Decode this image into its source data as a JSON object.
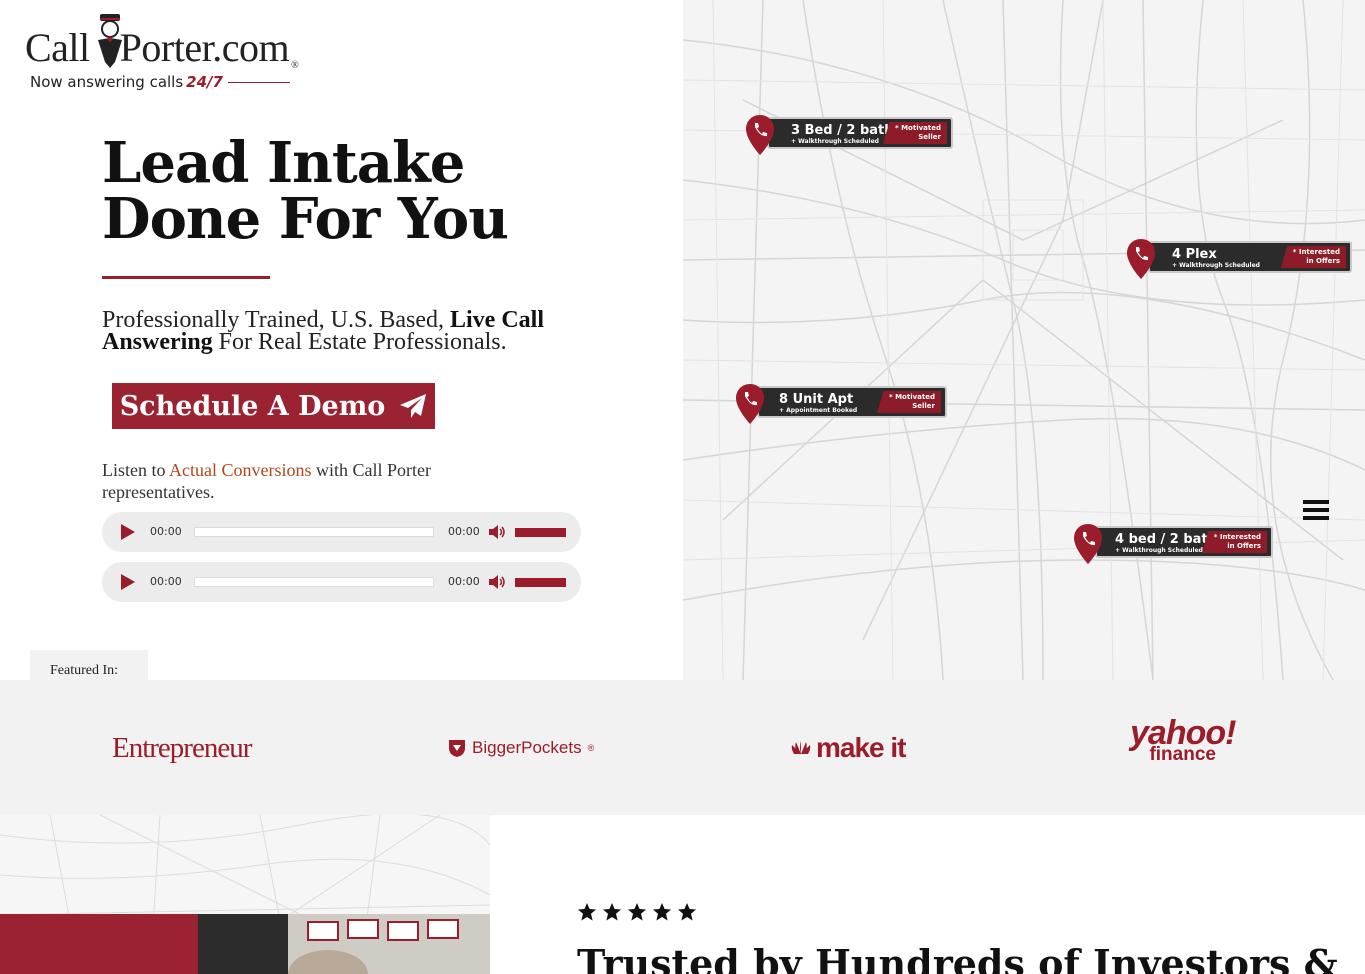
{
  "header": {
    "logo_text_left": "Call",
    "logo_text_right": "Porter.com",
    "logo_registered": "®",
    "tagline_prefix": "Now answering calls",
    "tagline_accent": "24/7"
  },
  "hero": {
    "headline_line1": "Lead Intake",
    "headline_line2": "Done For You",
    "subhead_part1": "Professionally Trained, U.S. Based, ",
    "subhead_bold": "Live Call Answering",
    "subhead_part2": " For Real Estate Professionals.",
    "cta_label": "Schedule A Demo",
    "cta_icon": "paper-plane-icon",
    "listen_prefix": "Listen to ",
    "listen_highlight": "Actual Conversions",
    "listen_suffix": " with Call Porter representatives."
  },
  "audio_players": [
    {
      "current_time": "00:00",
      "duration": "00:00",
      "volume_level": 1.0
    },
    {
      "current_time": "00:00",
      "duration": "00:00",
      "volume_level": 1.0
    }
  ],
  "featured": {
    "label": "Featured In:"
  },
  "map_pins": [
    {
      "title": "3 Bed / 2 bath",
      "detail": "+ Walkthrough Scheduled",
      "badge_line1": "* Motivated",
      "badge_line2": "Seller"
    },
    {
      "title": "4 Plex",
      "detail": "+ Walkthrough Scheduled",
      "badge_line1": "* Interested",
      "badge_line2": "in Offers"
    },
    {
      "title": "8 Unit Apt",
      "detail": "+ Appointment Booked",
      "badge_line1": "* Motivated",
      "badge_line2": "Seller"
    },
    {
      "title": "4 bed / 2 bath",
      "detail": "+ Walkthrough Scheduled",
      "badge_line1": "* Interested",
      "badge_line2": "in Offers"
    }
  ],
  "press_logos": {
    "entrepreneur": "Entrepreneur",
    "biggerpockets": "BiggerPockets",
    "biggerpockets_mark": "®",
    "makeit": "make it",
    "yahoo": "yahoo!",
    "finance": "finance"
  },
  "testimonial": {
    "star_count": 5,
    "heading": "Trusted by Hundreds of Investors &"
  },
  "colors": {
    "brand_red": "#9b1c2a",
    "cta_red": "#9b2230",
    "highlight_orange": "#b4461b",
    "pin_dark": "#2b2b2b"
  }
}
